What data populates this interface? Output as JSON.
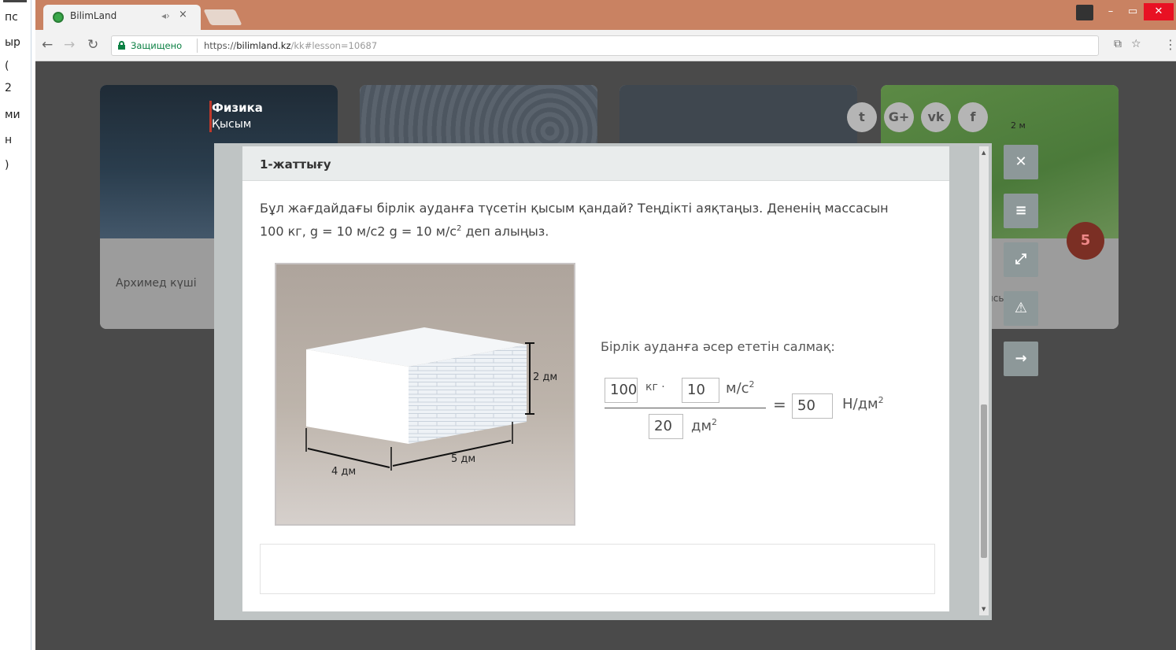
{
  "left_strip": {
    "lines": [
      "пс",
      "ыр",
      "(",
      "2",
      "ми",
      "н",
      ")"
    ]
  },
  "browser": {
    "tab_title": "BilimLand",
    "tab_audio": "◂›",
    "tab_close": "×",
    "window_controls": {
      "min": "–",
      "max": "▭",
      "close": "✕"
    },
    "secure_label": "Защищено",
    "url_scheme": "https://",
    "url_domain": "bilimland.kz",
    "url_path": "/kk#lesson=10687"
  },
  "cards": {
    "subject": "Физика",
    "topic": "Қысым",
    "caption_left": "Архимед күші",
    "caption_right": "қысымы.",
    "card4_label": "2 м"
  },
  "social": {
    "twitter": "t",
    "gplus": "G+",
    "vk": "vk",
    "facebook": "f"
  },
  "modal": {
    "title": "1-жаттығу",
    "question_part1": "Бұл жағдайдағы бірлік ауданға түсетін қысым қандай? Теңдікті аяқтаңыз. Дененің массасын 100 кг, g = 10 м/с2  g = 10 м/с",
    "question_sup": "2",
    "question_part2": " деп алыңыз.",
    "figure": {
      "height_label": "2 дм",
      "length_label": "5 дм",
      "width_label": "4 дм"
    },
    "rhs_label": "Бірлік ауданға әсер ететін салмақ:",
    "formula": {
      "mass_value": "100",
      "mass_unit": "кг ·",
      "g_value": "10",
      "g_unit": "м/с",
      "g_unit_sup": "2",
      "area_value": "20",
      "area_unit": "дм",
      "area_unit_sup": "2",
      "equals": "=",
      "result_value": "50",
      "result_unit": "Н/дм",
      "result_unit_sup": "2"
    }
  },
  "tools": {
    "close": "✕",
    "menu": "≡",
    "fullscreen": "⤢",
    "warning": "⚠",
    "next": "→"
  }
}
